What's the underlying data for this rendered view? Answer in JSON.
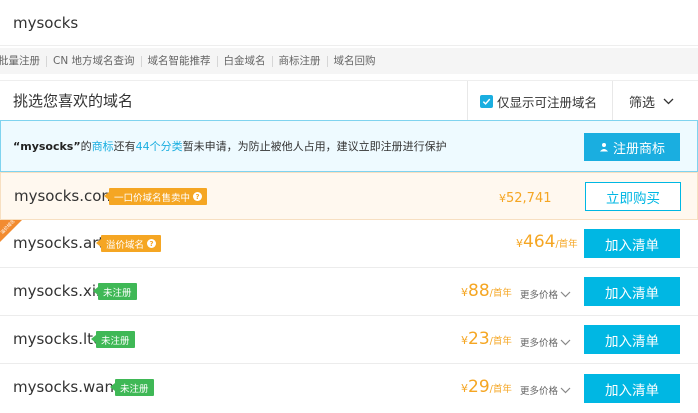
{
  "search": {
    "value": "mysocks"
  },
  "quick_links": [
    "批量注册",
    "CN 地方域名查询",
    "域名智能推荐",
    "白金域名",
    "商标注册",
    "域名回购"
  ],
  "filter_header": {
    "title": "挑选您喜欢的域名",
    "only_available_label": "仅显示可注册域名",
    "filter_label": "筛选"
  },
  "notice": {
    "quoted_name": "“mysocks”",
    "part1": "的",
    "trademark_link": "商标",
    "part2": "还有",
    "category_link": "44个分类",
    "part3": "暂未申请，为防止被他人占用，建议立即注册进行保护",
    "button_label": "注册商标"
  },
  "domains": [
    {
      "name": "mysocks.com",
      "badge": "一口价域名售卖中",
      "currency": "¥",
      "price": "52,741",
      "unit": "",
      "action": "立即购买"
    },
    {
      "name": "mysocks.art",
      "badge": "溢价域名",
      "corner": "溢价域名",
      "currency": "¥",
      "price": "464",
      "unit": "/首年",
      "action": "加入清单"
    },
    {
      "name": "mysocks.xin",
      "badge": "未注册",
      "currency": "¥",
      "price": "88",
      "unit": "/首年",
      "more": "更多价格",
      "action": "加入清单"
    },
    {
      "name": "mysocks.ltd",
      "badge": "未注册",
      "currency": "¥",
      "price": "23",
      "unit": "/首年",
      "more": "更多价格",
      "action": "加入清单"
    },
    {
      "name": "mysocks.wang",
      "badge": "未注册",
      "currency": "¥",
      "price": "29",
      "unit": "/首年",
      "more": "更多价格",
      "action": "加入清单"
    }
  ],
  "colors": {
    "accent": "#00b7e3",
    "price": "#f5a623",
    "available": "#3fb856"
  }
}
